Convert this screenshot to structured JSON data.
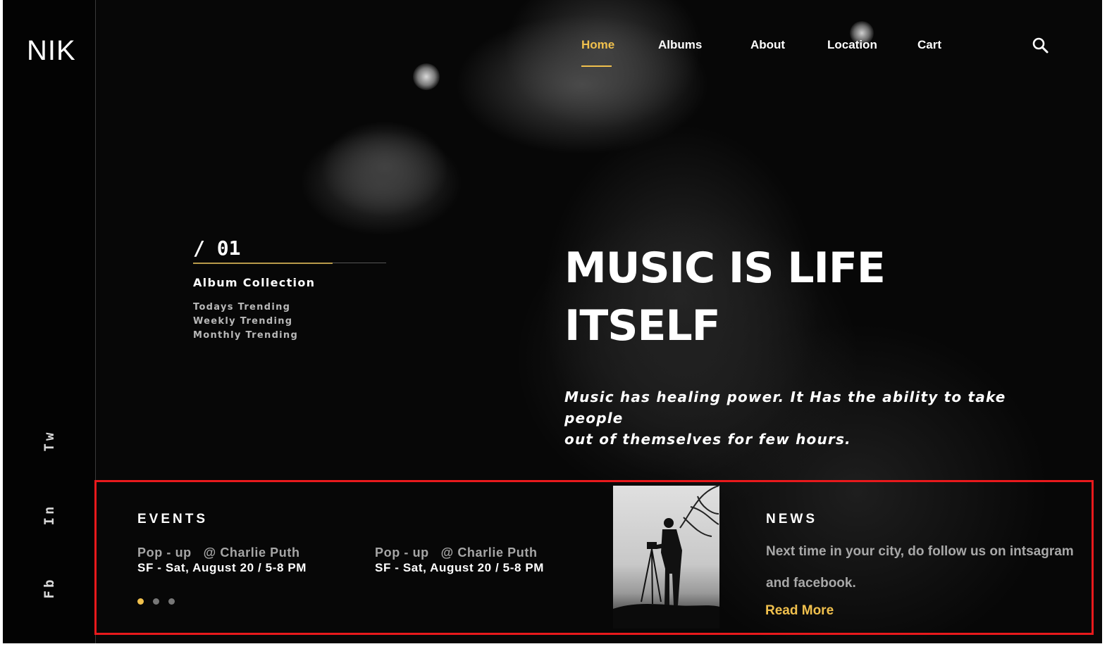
{
  "brand": {
    "logo": "NIK"
  },
  "social": {
    "twitter": "Tw",
    "instagram": "In",
    "facebook": "Fb"
  },
  "nav": {
    "items": [
      {
        "label": "Home",
        "active": true
      },
      {
        "label": "Albums"
      },
      {
        "label": "About"
      },
      {
        "label": "Location"
      },
      {
        "label": "Cart"
      }
    ],
    "search_icon": "search-icon",
    "accent_color": "#f0c04d"
  },
  "album": {
    "counter": "/ 01",
    "title": "Album Collection",
    "links": [
      "Todays Trending",
      "Weekly Trending",
      "Monthly Trending"
    ]
  },
  "hero": {
    "headline_line1": "MUSIC IS LIFE",
    "headline_line2": "ITSELF",
    "tagline_line1": "Music has healing power. It Has the ability to take people",
    "tagline_line2": "out of themselves for few hours."
  },
  "events": {
    "title": "EVENTS",
    "items": [
      {
        "name": "Pop - up   @ Charlie Puth",
        "detail": "SF - Sat, August 20 / 5-8 PM"
      },
      {
        "name": "Pop - up   @ Charlie Puth",
        "detail": "SF - Sat, August 20 / 5-8 PM"
      }
    ],
    "carousel": {
      "count": 3,
      "active_index": 0
    }
  },
  "news": {
    "title": "NEWS",
    "text_line1": "Next time in your city, do follow us on intsagram",
    "text_line2": "and facebook.",
    "read_more": "Read More"
  }
}
